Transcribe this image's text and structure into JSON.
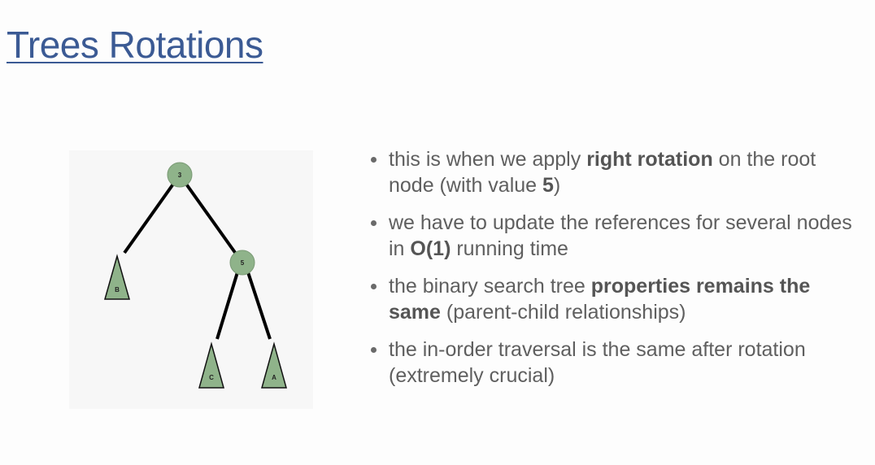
{
  "slide": {
    "title": "Trees Rotations"
  },
  "tree": {
    "node_color": "#8fb38a",
    "nodes": [
      {
        "id": "3",
        "label": "3"
      },
      {
        "id": "5",
        "label": "5"
      }
    ],
    "subtrees": [
      {
        "id": "B",
        "label": "B"
      },
      {
        "id": "C",
        "label": "C"
      },
      {
        "id": "A",
        "label": "A"
      }
    ]
  },
  "bullets": [
    {
      "parts": [
        {
          "text": "this is when we apply ",
          "bold": false
        },
        {
          "text": "right rotation",
          "bold": true
        },
        {
          "text": " on the root node (with value ",
          "bold": false
        },
        {
          "text": "5",
          "bold": true
        },
        {
          "text": ")",
          "bold": false
        }
      ]
    },
    {
      "parts": [
        {
          "text": "we have to update the references for several nodes in ",
          "bold": false
        },
        {
          "text": "O(1)",
          "bold": true
        },
        {
          "text": " running time",
          "bold": false
        }
      ]
    },
    {
      "parts": [
        {
          "text": "the binary search tree ",
          "bold": false
        },
        {
          "text": "properties remains the same",
          "bold": true
        },
        {
          "text": " (parent-child relationships)",
          "bold": false
        }
      ]
    },
    {
      "parts": [
        {
          "text": "the in-order traversal is the same after rotation (extremely crucial)",
          "bold": false
        }
      ]
    }
  ]
}
